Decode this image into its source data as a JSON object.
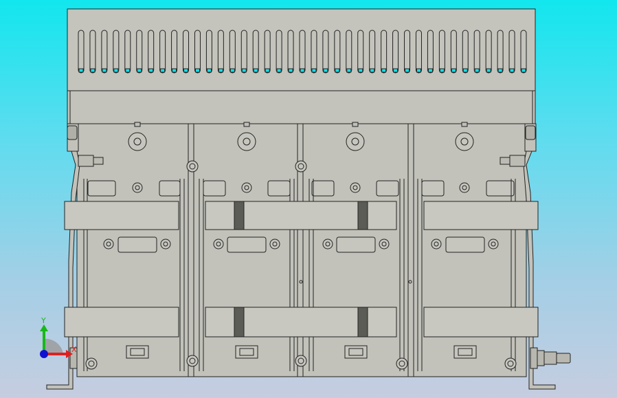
{
  "viewport": {
    "background_top": "#12e6ee",
    "background_bottom": "#c6cde0",
    "part_fill": "#c0c0b8",
    "edge_color": "#222222",
    "slot_highlight": "#16e0ea"
  },
  "model": {
    "fan_slot_count": 39,
    "bays": 4
  },
  "triad": {
    "x_label": "X",
    "y_label": "Y",
    "x_color": "#e02020",
    "y_color": "#18b818",
    "z_color": "#1010d0"
  }
}
